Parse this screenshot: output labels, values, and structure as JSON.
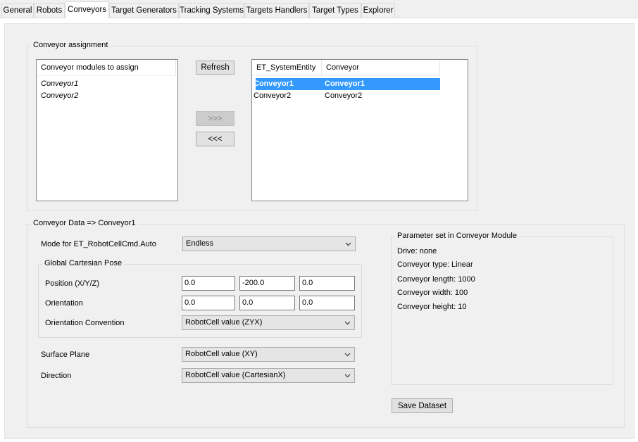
{
  "tabs": [
    {
      "label": "General"
    },
    {
      "label": "Robots"
    },
    {
      "label": "Conveyors"
    },
    {
      "label": "Target Generators"
    },
    {
      "label": "Tracking Systems"
    },
    {
      "label": "Targets Handlers"
    },
    {
      "label": "Target Types"
    },
    {
      "label": "Explorer"
    }
  ],
  "assignment": {
    "title": "Conveyor assignment",
    "modules_header": "Conveyor modules to assign",
    "modules": [
      "Conveyor1",
      "Conveyor2"
    ],
    "refresh_label": "Refresh",
    "assign_label": ">>>",
    "unassign_label": "<<<",
    "table_headers": [
      "ET_SystemEntity",
      "Conveyor"
    ],
    "rows": [
      {
        "entity": "Conveyor1",
        "conveyor": "Conveyor1"
      },
      {
        "entity": "Conveyor2",
        "conveyor": "Conveyor2"
      }
    ]
  },
  "data": {
    "title": "Conveyor Data => Conveyor1",
    "mode_label": "Mode for ET_RobotCellCmd.Auto",
    "mode_value": "Endless",
    "pose_title": "Global Cartesian Pose",
    "position_label": "Position (X/Y/Z)",
    "position_values": [
      "0.0",
      "-200.0",
      "0.0"
    ],
    "orientation_label": "Orientation",
    "orientation_values": [
      "0.0",
      "0.0",
      "0.0"
    ],
    "convention_label": "Orientation Convention",
    "convention_value": "RobotCell value (ZYX)",
    "surface_label": "Surface Plane",
    "surface_value": "RobotCell value (XY)",
    "direction_label": "Direction",
    "direction_value": "RobotCell value (CartesianX)",
    "save_label": "Save Dataset"
  },
  "params": {
    "title": "Parameter set in Conveyor Module",
    "lines": [
      "Drive: none",
      "Conveyor type: Linear",
      "Conveyor length: 1000",
      "Conveyor width: 100",
      "Conveyor height: 10"
    ]
  }
}
